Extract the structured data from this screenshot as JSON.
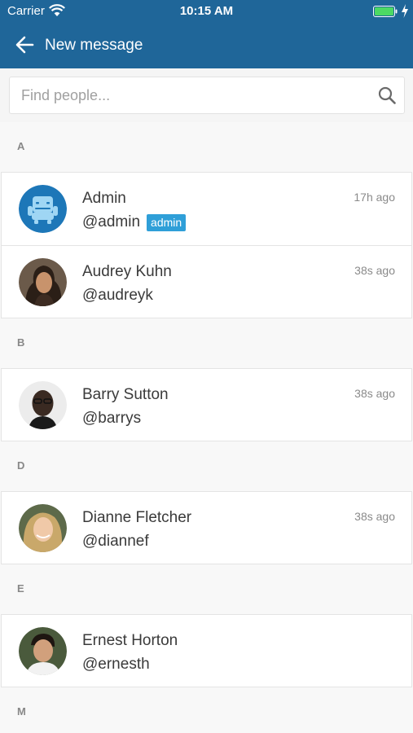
{
  "status": {
    "carrier": "Carrier",
    "time": "10:15 AM"
  },
  "header": {
    "title": "New message"
  },
  "search": {
    "placeholder": "Find people..."
  },
  "colors": {
    "header": "#1f6699",
    "badge": "#2f9fd8",
    "battery": "#4cd964"
  },
  "sections": [
    {
      "letter": "A",
      "people": [
        {
          "name": "Admin",
          "handle": "@admin",
          "badge": "admin",
          "time": "17h ago",
          "avatar": "admin-robot-avatar"
        },
        {
          "name": "Audrey Kuhn",
          "handle": "@audreyk",
          "time": "38s ago",
          "avatar": "photo-avatar"
        }
      ]
    },
    {
      "letter": "B",
      "people": [
        {
          "name": "Barry Sutton",
          "handle": "@barrys",
          "time": "38s ago",
          "avatar": "photo-avatar"
        }
      ]
    },
    {
      "letter": "D",
      "people": [
        {
          "name": "Dianne Fletcher",
          "handle": "@diannef",
          "time": "38s ago",
          "avatar": "photo-avatar"
        }
      ]
    },
    {
      "letter": "E",
      "people": [
        {
          "name": "Ernest Horton",
          "handle": "@ernesth",
          "time": "",
          "avatar": "photo-avatar"
        }
      ]
    },
    {
      "letter": "M",
      "people": []
    }
  ]
}
